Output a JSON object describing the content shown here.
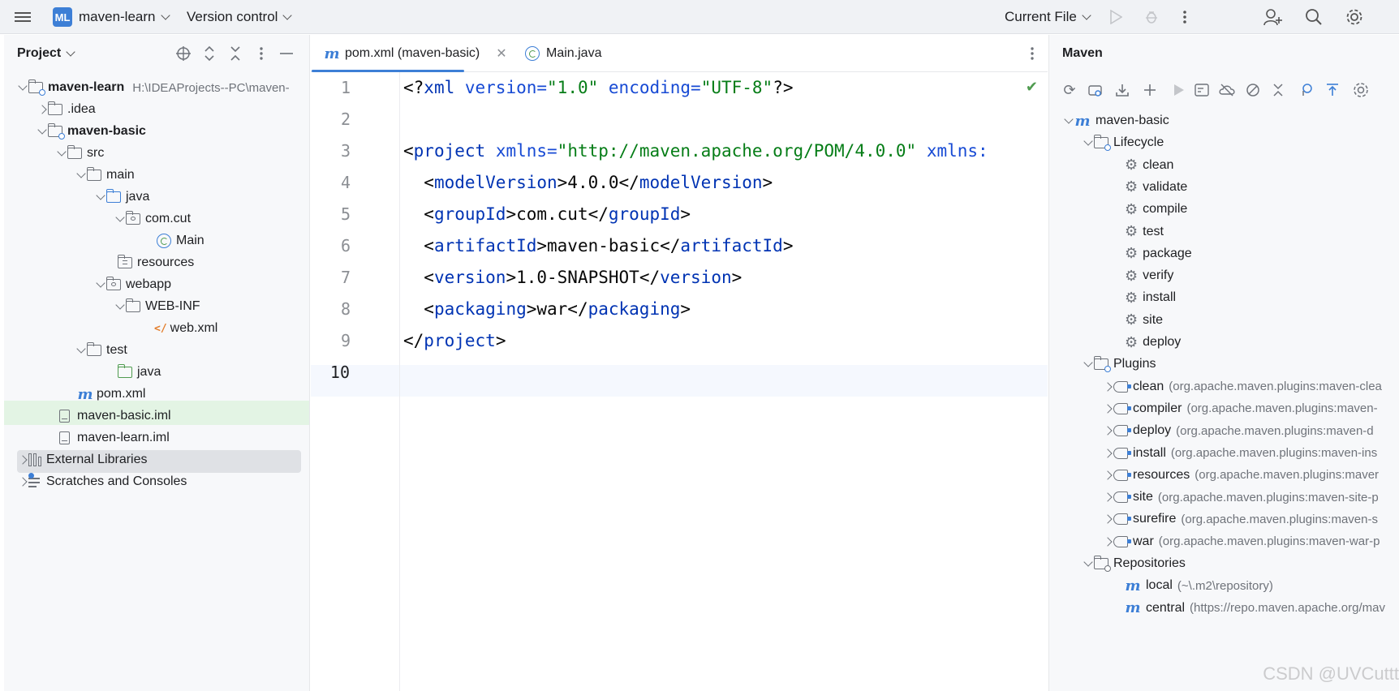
{
  "titlebar": {
    "project_badge": "ML",
    "project_name": "maven-learn",
    "vcs_label": "Version control",
    "run_config": "Current File",
    "icons": [
      "hamburger-menu-icon",
      "run-icon",
      "debug-icon",
      "more-vertical-icon",
      "add-user-icon",
      "search-icon",
      "settings-gear-icon"
    ]
  },
  "project_panel": {
    "title": "Project",
    "toolbar_icons": [
      "locate-icon",
      "expand-all-icon",
      "collapse-all-icon",
      "options-icon",
      "hide-icon"
    ],
    "tree": [
      {
        "label": "maven-learn",
        "detail": "H:\\IDEAProjects--PC\\maven-",
        "bold": true
      },
      {
        "label": ".idea"
      },
      {
        "label": "maven-basic",
        "bold": true
      },
      {
        "label": "src"
      },
      {
        "label": "main"
      },
      {
        "label": "java"
      },
      {
        "label": "com.cut"
      },
      {
        "label": "Main"
      },
      {
        "label": "resources"
      },
      {
        "label": "webapp"
      },
      {
        "label": "WEB-INF"
      },
      {
        "label": "web.xml"
      },
      {
        "label": "test"
      },
      {
        "label": "java"
      },
      {
        "label": "pom.xml"
      },
      {
        "label": "maven-basic.iml"
      },
      {
        "label": "maven-learn.iml"
      },
      {
        "label": "External Libraries"
      },
      {
        "label": "Scratches and Consoles"
      }
    ]
  },
  "editor": {
    "tabs": [
      {
        "label": "pom.xml (maven-basic)",
        "active": true
      },
      {
        "label": "Main.java",
        "active": false
      }
    ],
    "line_numbers": [
      "1",
      "2",
      "3",
      "4",
      "5",
      "6",
      "7",
      "8",
      "9",
      "10"
    ],
    "lines": [
      [
        {
          "t": "<?",
          "c": "t-txt"
        },
        {
          "t": "xml ",
          "c": "t-tag"
        },
        {
          "t": "version=",
          "c": "t-attr"
        },
        {
          "t": "\"1.0\"",
          "c": "t-str"
        },
        {
          "t": " ",
          "c": "t-txt"
        },
        {
          "t": "encoding=",
          "c": "t-attr"
        },
        {
          "t": "\"UTF-8\"",
          "c": "t-str"
        },
        {
          "t": "?>",
          "c": "t-txt"
        }
      ],
      [],
      [
        {
          "t": "<",
          "c": "t-txt"
        },
        {
          "t": "project ",
          "c": "t-tag"
        },
        {
          "t": "xmlns=",
          "c": "t-attr"
        },
        {
          "t": "\"http://maven.apache.org/POM/4.0.0\"",
          "c": "t-str"
        },
        {
          "t": " ",
          "c": "t-txt"
        },
        {
          "t": "xmlns:",
          "c": "t-attr"
        }
      ],
      [
        {
          "t": "  <",
          "c": "t-txt"
        },
        {
          "t": "modelVersion",
          "c": "t-tag"
        },
        {
          "t": ">4.0.0</",
          "c": "t-txt"
        },
        {
          "t": "modelVersion",
          "c": "t-tag"
        },
        {
          "t": ">",
          "c": "t-txt"
        }
      ],
      [
        {
          "t": "  <",
          "c": "t-txt"
        },
        {
          "t": "groupId",
          "c": "t-tag"
        },
        {
          "t": ">com.cut</",
          "c": "t-txt"
        },
        {
          "t": "groupId",
          "c": "t-tag"
        },
        {
          "t": ">",
          "c": "t-txt"
        }
      ],
      [
        {
          "t": "  <",
          "c": "t-txt"
        },
        {
          "t": "artifactId",
          "c": "t-tag"
        },
        {
          "t": ">maven-basic</",
          "c": "t-txt"
        },
        {
          "t": "artifactId",
          "c": "t-tag"
        },
        {
          "t": ">",
          "c": "t-txt"
        }
      ],
      [
        {
          "t": "  <",
          "c": "t-txt"
        },
        {
          "t": "version",
          "c": "t-tag"
        },
        {
          "t": ">1.0-SNAPSHOT</",
          "c": "t-txt"
        },
        {
          "t": "version",
          "c": "t-tag"
        },
        {
          "t": ">",
          "c": "t-txt"
        }
      ],
      [
        {
          "t": "  <",
          "c": "t-txt"
        },
        {
          "t": "packaging",
          "c": "t-tag"
        },
        {
          "t": ">war</",
          "c": "t-txt"
        },
        {
          "t": "packaging",
          "c": "t-tag"
        },
        {
          "t": ">",
          "c": "t-txt"
        }
      ],
      [
        {
          "t": "</",
          "c": "t-txt"
        },
        {
          "t": "project",
          "c": "t-tag"
        },
        {
          "t": ">",
          "c": "t-txt"
        }
      ],
      []
    ],
    "status_icon": "check-icon"
  },
  "maven_panel": {
    "title": "Maven",
    "toolbar_icons": [
      "reload-icon",
      "generate-sources-icon",
      "download-icon",
      "add-icon",
      "run-icon",
      "execute-goal-icon",
      "offline-icon",
      "skip-tests-icon",
      "collapse-icon",
      "show-dependencies-icon",
      "expand-icon",
      "settings-icon"
    ],
    "tree": [
      {
        "label": "maven-basic"
      },
      {
        "label": "Lifecycle"
      },
      {
        "label": "clean"
      },
      {
        "label": "validate"
      },
      {
        "label": "compile"
      },
      {
        "label": "test"
      },
      {
        "label": "package"
      },
      {
        "label": "verify"
      },
      {
        "label": "install"
      },
      {
        "label": "site"
      },
      {
        "label": "deploy"
      },
      {
        "label": "Plugins"
      },
      {
        "label": "clean",
        "detail": "(org.apache.maven.plugins:maven-clea"
      },
      {
        "label": "compiler",
        "detail": "(org.apache.maven.plugins:maven-"
      },
      {
        "label": "deploy",
        "detail": "(org.apache.maven.plugins:maven-d"
      },
      {
        "label": "install",
        "detail": "(org.apache.maven.plugins:maven-ins"
      },
      {
        "label": "resources",
        "detail": "(org.apache.maven.plugins:maver"
      },
      {
        "label": "site",
        "detail": "(org.apache.maven.plugins:maven-site-p"
      },
      {
        "label": "surefire",
        "detail": "(org.apache.maven.plugins:maven-s"
      },
      {
        "label": "war",
        "detail": "(org.apache.maven.plugins:maven-war-p"
      },
      {
        "label": "Repositories"
      },
      {
        "label": "local",
        "detail": "(~\\.m2\\repository)"
      },
      {
        "label": "central",
        "detail": "(https://repo.maven.apache.org/mav"
      }
    ]
  },
  "watermark": "CSDN @UVCuttt",
  "colors": {
    "accent": "#3d7fd6",
    "tag": "#0033b3",
    "string": "#067d17",
    "selection": "#dfe1e5",
    "highlight": "#e3f4e4"
  }
}
